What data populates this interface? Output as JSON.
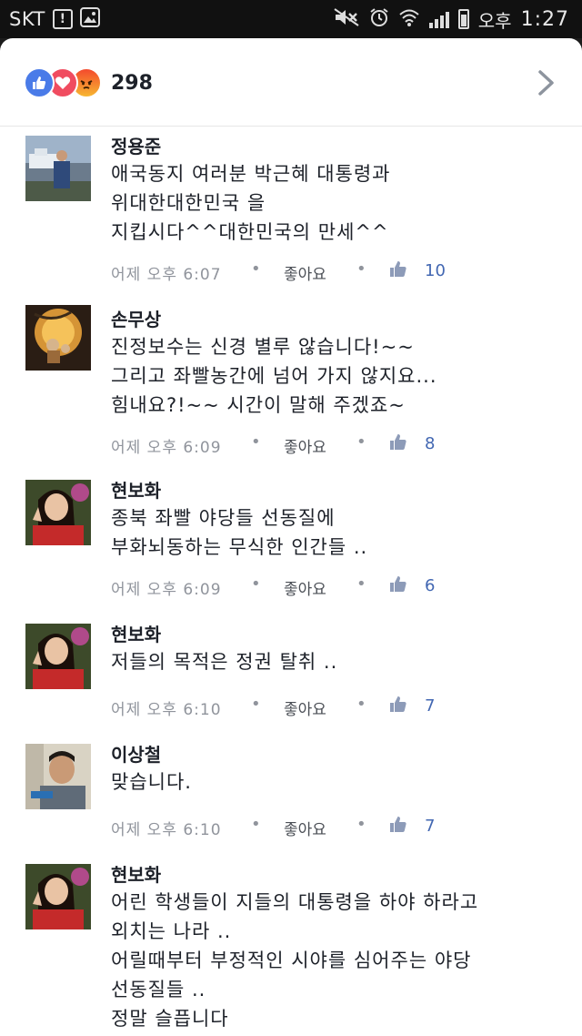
{
  "status_bar": {
    "carrier": "SKT",
    "ampm": "오후",
    "time": "1:27"
  },
  "reactions": {
    "count": "298",
    "icons": [
      "like-icon",
      "love-icon",
      "angry-icon"
    ]
  },
  "comments": [
    {
      "author": "정용준",
      "lines": [
        "애국동지 여러분 박근혜 대통령과",
        "위대한대한민국 을",
        "지킵시다^^대한민국의 만세^^"
      ],
      "time": "어제 오후 6:07",
      "like_label": "좋아요",
      "likes": "10"
    },
    {
      "author": "손무상",
      "lines": [
        "진정보수는 신경 별루 않습니다!~~",
        "그리고 좌빨농간에 넘어 가지 않지요...",
        "힘내요?!~~ 시간이 말해 주겠죠~"
      ],
      "time": "어제 오후 6:09",
      "like_label": "좋아요",
      "likes": "8"
    },
    {
      "author": "현보화",
      "lines": [
        "종북 좌빨 야당들 선동질에",
        "부화뇌동하는 무식한 인간들 .."
      ],
      "time": "어제 오후 6:09",
      "like_label": "좋아요",
      "likes": "6"
    },
    {
      "author": "현보화",
      "lines": [
        "저들의 목적은 정권 탈취 .."
      ],
      "time": "어제 오후 6:10",
      "like_label": "좋아요",
      "likes": "7"
    },
    {
      "author": "이상철",
      "lines": [
        "맞습니다."
      ],
      "time": "어제 오후 6:10",
      "like_label": "좋아요",
      "likes": "7"
    },
    {
      "author": "현보화",
      "lines": [
        "어린 학생들이 지들의 대통령을 하야 하라고",
        "외치는 나라 ..",
        "어릴때부터 부정적인 시야를 심어주는 야당",
        "선동질들 ..",
        "정말 슬픕니다"
      ],
      "time": "",
      "like_label": "",
      "likes": ""
    }
  ]
}
